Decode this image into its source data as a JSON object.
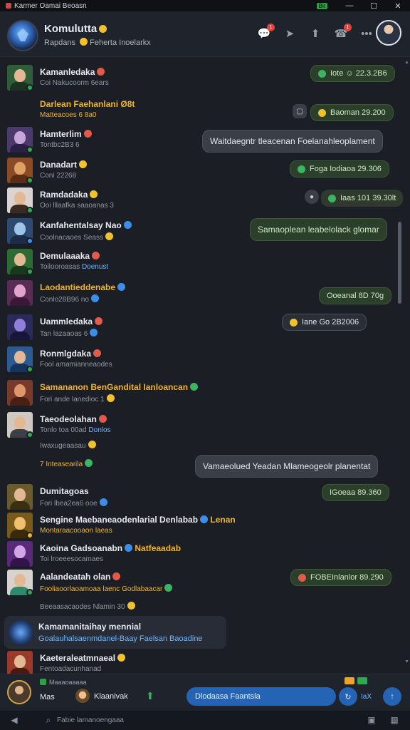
{
  "window": {
    "title": "Karmer Oamai Beoasn",
    "badge": "Bit"
  },
  "header": {
    "title": "Komulutta",
    "subtitle_left": "Rapdans",
    "subtitle_right": "Feherta Inoelarkx",
    "actions": [
      {
        "icon": "chat-icon",
        "badge": "1"
      },
      {
        "icon": "bird-icon",
        "badge": ""
      },
      {
        "icon": "pin-icon",
        "badge": ""
      },
      {
        "icon": "phone-icon",
        "badge": "1"
      },
      {
        "icon": "more-icon",
        "badge": ""
      }
    ]
  },
  "messages": [
    {
      "name": "Kamanledaka",
      "sub": "Coi Nakucoorm 6ears",
      "bubble": "Iote ☺ 22.3.2B6"
    },
    {
      "name": "Darlean Faehanlani Ø8t",
      "sub": "Matteacoes 6 8a0",
      "bubble": "Baoman 29.200"
    },
    {
      "name": "Hamterlim",
      "sub": "Tontbc2B3 6",
      "bubble": "Waitdaegntr tleacenan Foelanahleoplament"
    },
    {
      "name": "Danadart",
      "sub": "Coni 22268",
      "bubble": "Foga Iodiaoa 29.306"
    },
    {
      "name": "Ramdadaka",
      "sub": "Ooi lllaafka saaoanas 3",
      "bubble": "Iaas 101 39.30lt"
    },
    {
      "name": "Kanfahentalsay Nao",
      "sub": "Coolnacaoes Seass",
      "bubble": "Samaoplean leabelolack glomar"
    },
    {
      "name": "Demulaaaka",
      "sub": "Toilooroasas",
      "sub_hl": "Doenust"
    },
    {
      "name": "Laodantieddenabe",
      "sub": "Conlo28B96 no",
      "bubble": "Ooeanal 8D 70g"
    },
    {
      "name": "Uammledaka",
      "sub": "Tan lazaaoas 6",
      "bubble": "Iane Go 2B2006"
    },
    {
      "name": "Ronmlgdaka",
      "sub": "Fool amamianneaodes"
    },
    {
      "name": "Samananon BenGandital Ianloancan",
      "sub": "Fori ande lanedioc 1"
    },
    {
      "name": "Taeodeolahan",
      "sub": "Tonlo toa 00ad",
      "sub_hl": "Donlos",
      "extra": "Iwaxugeaasau"
    },
    {
      "name": "",
      "sub": "7 Inteasearila",
      "bubble": "Vamaeolued Yeadan Mlameogeolr planentat"
    },
    {
      "name": "Dumitagoas",
      "sub": "Fori lbea2ea6 ooe",
      "bubble": "IGoeaa 89.360"
    },
    {
      "name": "Sengine Maebaneaodenlarial Denlabab",
      "sub": "Montaraacooaon laeas",
      "name_tail": "Lenan"
    },
    {
      "name": "Kaoina Gadsoanabn",
      "sub": "Toi lroeeesocamaes",
      "name_tail": "Natfeaadab"
    },
    {
      "name": "Aalandeatah olan",
      "sub": "Fooliaoorlaoamoaa laenc Godlabaacar",
      "bubble": "FOBEInlanlor 89.290"
    },
    {
      "name": "",
      "sub": "Beeaasacaodes Nlamin 30"
    }
  ],
  "highlight": {
    "title": "Kamamanitaihay mennial",
    "subtitle": "Goalauhalsaenmdanel-Baay Faelsan Baoadine"
  },
  "last": {
    "name": "Kaeteraleatmnaeal",
    "sub": "Fentoadacunhanad"
  },
  "composer": {
    "me_top": "Maaaoaaaaa",
    "me_label": "Mas",
    "peer_label": "Klaanivak",
    "input_value": "Dlodaasa Faantsla",
    "count": "IaX"
  },
  "statusbar": {
    "text": "Fabie lamanoengaaa"
  },
  "colors": {
    "accent": "#2563b5",
    "online": "#2fa84f",
    "gold": "#f0b429",
    "link": "#6cb6ff"
  }
}
